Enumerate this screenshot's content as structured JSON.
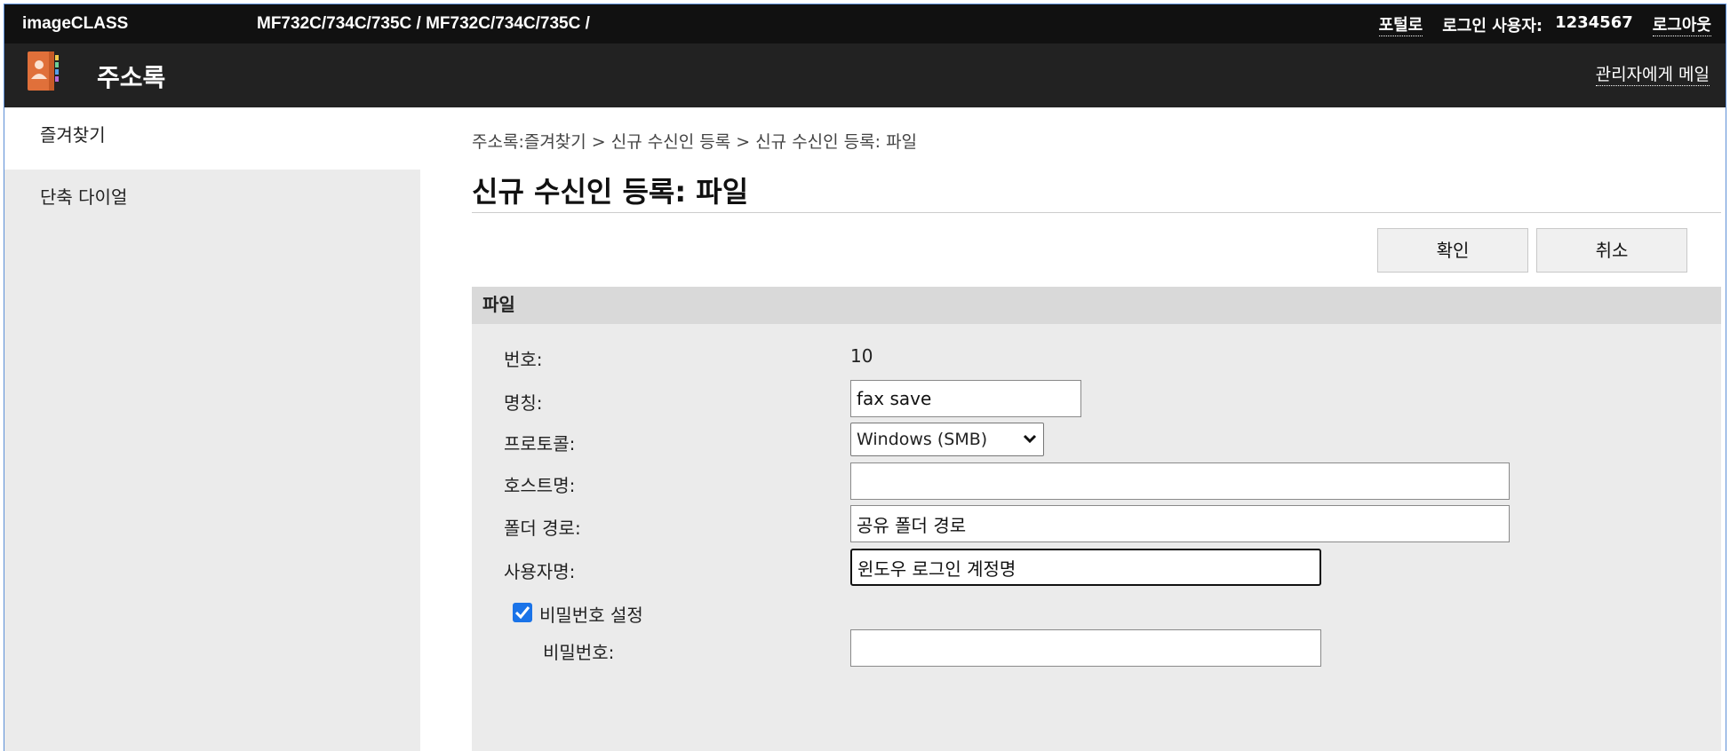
{
  "topbar": {
    "brand": "imageCLASS",
    "model": "MF732C/734C/735C / MF732C/734C/735C /",
    "portal_link": "포털로",
    "login_label": "로그인 사용자:",
    "login_user": "1234567",
    "logout_link": "로그아웃"
  },
  "titlebar": {
    "title": "주소록",
    "icon": "address-book-icon",
    "mail_link": "관리자에게 메일"
  },
  "sidebar": {
    "items": [
      {
        "label": "즐겨찾기",
        "active": true
      },
      {
        "label": "단축 다이얼",
        "active": false
      }
    ]
  },
  "main": {
    "breadcrumb": "주소록:즐겨찾기 > 신규 수신인 등록 > 신규 수신인 등록: 파일",
    "title": "신규 수신인 등록: 파일",
    "ok_button": "확인",
    "cancel_button": "취소",
    "panel_title": "파일",
    "fields": {
      "number_label": "번호:",
      "number_value": "10",
      "name_label": "명칭:",
      "name_value": "fax save",
      "protocol_label": "프로토콜:",
      "protocol_value": "Windows (SMB)",
      "host_label": "호스트명:",
      "host_value": "",
      "folder_label": "폴더 경로:",
      "folder_value": "공유 폴더 경로",
      "user_label": "사용자명:",
      "user_value": "윈도우 로그인 계정명",
      "password_checkbox_label": "비밀번호 설정",
      "password_checked": true,
      "password_label": "비밀번호:",
      "password_value": ""
    }
  },
  "colors": {
    "topbar": "#111111",
    "titlebar": "#222222",
    "sidebar": "#ebebeb",
    "panel": "#ebebeb",
    "panel_header": "#d9d9d9",
    "checkbox": "#1a73e8",
    "icon_orange": "#e0703a"
  }
}
